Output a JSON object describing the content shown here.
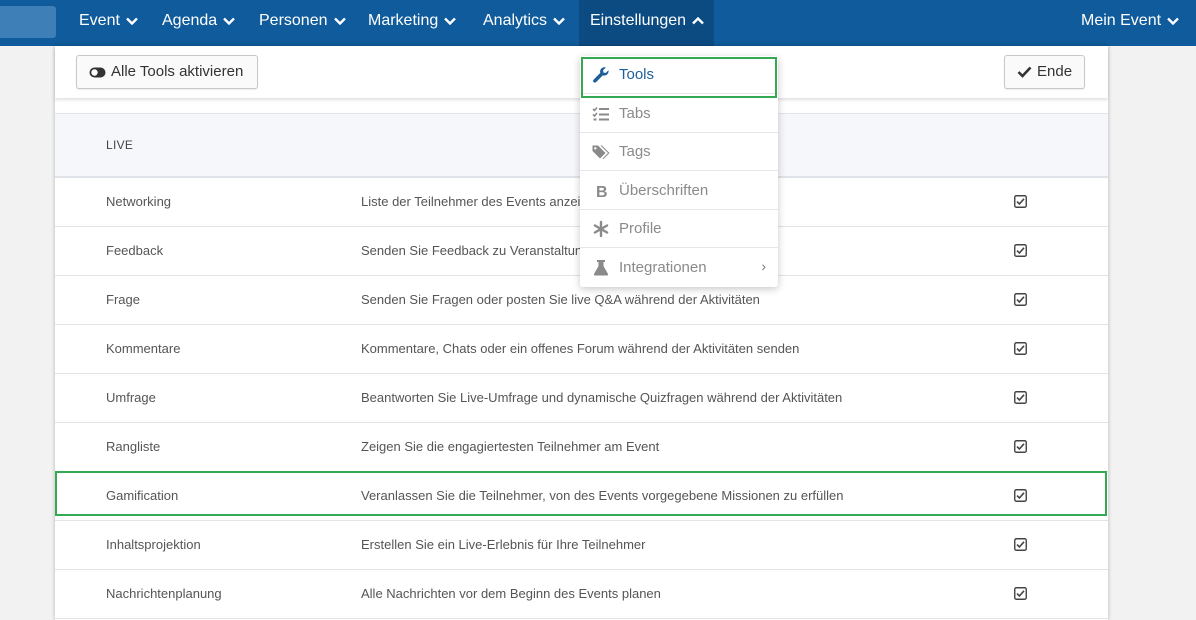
{
  "nav": {
    "items": [
      {
        "label": "Event"
      },
      {
        "label": "Agenda"
      },
      {
        "label": "Personen"
      },
      {
        "label": "Marketing"
      },
      {
        "label": "Analytics"
      },
      {
        "label": "Einstellungen"
      }
    ],
    "right_label": "Mein Event"
  },
  "toolbar": {
    "activate_label": "Alle Tools aktivieren",
    "end_label": "Ende"
  },
  "section": {
    "title": "LIVE"
  },
  "rows": [
    {
      "name": "Networking",
      "desc": "Liste der Teilnehmer des Events anzeigen",
      "checked": true
    },
    {
      "name": "Feedback",
      "desc": "Senden Sie Feedback zu Veranstaltungen",
      "checked": true
    },
    {
      "name": "Frage",
      "desc": "Senden Sie Fragen oder posten Sie live Q&A während der Aktivitäten",
      "checked": true
    },
    {
      "name": "Kommentare",
      "desc": "Kommentare, Chats oder ein offenes Forum während der Aktivitäten senden",
      "checked": true
    },
    {
      "name": "Umfrage",
      "desc": "Beantworten Sie Live-Umfrage und dynamische Quizfragen während der Aktivitäten",
      "checked": true
    },
    {
      "name": "Rangliste",
      "desc": "Zeigen Sie die engagiertesten Teilnehmer am Event",
      "checked": true
    },
    {
      "name": "Gamification",
      "desc": "Veranlassen Sie die Teilnehmer, von des Events vorgegebene Missionen zu erfüllen",
      "checked": true
    },
    {
      "name": "Inhaltsprojektion",
      "desc": "Erstellen Sie ein Live-Erlebnis für Ihre Teilnehmer",
      "checked": true
    },
    {
      "name": "Nachrichtenplanung",
      "desc": "Alle Nachrichten vor dem Beginn des Events planen",
      "checked": true
    }
  ],
  "dropdown": {
    "items": [
      {
        "label": "Tools",
        "icon": "wrench-icon"
      },
      {
        "label": "Tabs",
        "icon": "list-check-icon"
      },
      {
        "label": "Tags",
        "icon": "tags-icon"
      },
      {
        "label": "Überschriften",
        "icon": "bold-icon"
      },
      {
        "label": "Profile",
        "icon": "asterisk-icon"
      },
      {
        "label": "Integrationen",
        "icon": "flask-icon",
        "has_submenu": true
      }
    ]
  },
  "colors": {
    "nav_bg": "#0f5b9b",
    "highlight": "#34a853",
    "link": "#1e5f99"
  }
}
